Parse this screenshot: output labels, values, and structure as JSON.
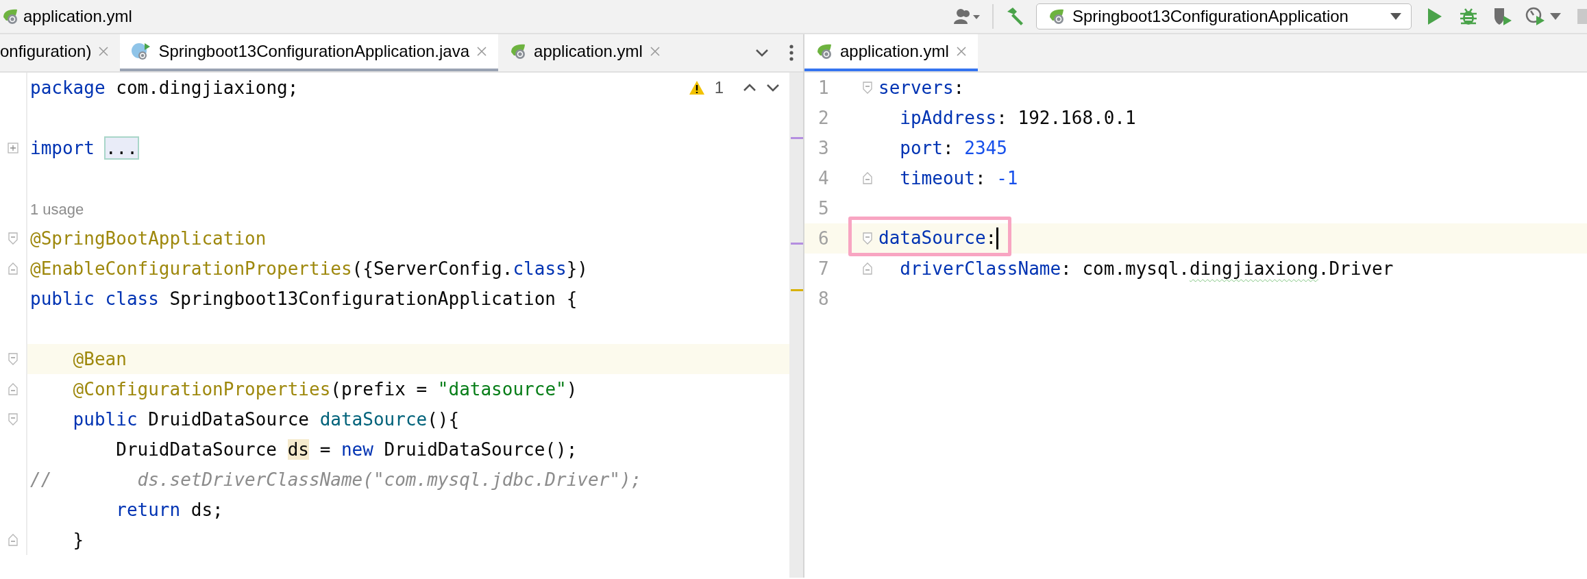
{
  "title_bar": {
    "file_name": "application.yml",
    "run_configuration": "Springboot13ConfigurationApplication"
  },
  "left_editor": {
    "active": false,
    "tabs": [
      {
        "label": "onfiguration)",
        "kind": "plain",
        "selected": false
      },
      {
        "label": "Springboot13ConfigurationApplication.java",
        "kind": "java",
        "selected": true
      },
      {
        "label": "application.yml",
        "kind": "yaml",
        "selected": false
      }
    ],
    "warning_count": "1",
    "lines": [
      {
        "kind": "plain",
        "current": false,
        "tokens": [
          {
            "t": "package",
            "kind": "keyword"
          },
          {
            "t": " com.dingjiaxiong;",
            "kind": "text"
          }
        ]
      },
      {
        "kind": "plain",
        "current": false
      },
      {
        "kind": "collapsed",
        "current": false,
        "tokens": [
          {
            "t": "import",
            "kind": "keyword"
          },
          {
            "t": " ...",
            "kind": "placeholder"
          }
        ]
      },
      {
        "kind": "plain",
        "current": false
      },
      {
        "kind": "plain",
        "current": false,
        "tokens": [
          {
            "t": "1 usage",
            "kind": "hint"
          }
        ]
      },
      {
        "kind": "fold-start",
        "current": false,
        "tokens": [
          {
            "t": "@SpringBootApplication",
            "kind": "annotation"
          }
        ]
      },
      {
        "kind": "fold-end",
        "current": false,
        "tokens": [
          {
            "t": "@EnableConfigurationProperties",
            "kind": "annotation"
          },
          {
            "t": "({ServerConfig.",
            "kind": "text"
          },
          {
            "t": "class",
            "kind": "keyword"
          },
          {
            "t": "})",
            "kind": "text"
          }
        ]
      },
      {
        "kind": "plain",
        "current": false,
        "tokens": [
          {
            "t": "public class",
            "kind": "keyword"
          },
          {
            "t": " Springboot13ConfigurationApplication {",
            "kind": "text"
          }
        ]
      },
      {
        "kind": "plain",
        "current": false
      },
      {
        "kind": "fold-start",
        "current": true,
        "tokens": [
          {
            "t": "    @Bean",
            "kind": "annotation"
          }
        ]
      },
      {
        "kind": "fold-end",
        "current": false,
        "tokens": [
          {
            "t": "    @ConfigurationProperties",
            "kind": "annotation"
          },
          {
            "t": "(prefix = ",
            "kind": "text"
          },
          {
            "t": "\"datasource\"",
            "kind": "string"
          },
          {
            "t": ")",
            "kind": "text"
          }
        ]
      },
      {
        "kind": "fold-start",
        "current": false,
        "tokens": [
          {
            "t": "    public",
            "kind": "keyword"
          },
          {
            "t": " DruidDataSource ",
            "kind": "text"
          },
          {
            "t": "dataSource",
            "kind": "method"
          },
          {
            "t": "(){",
            "kind": "text"
          }
        ]
      },
      {
        "kind": "plain",
        "current": false,
        "tokens": [
          {
            "t": "        DruidDataSource ",
            "kind": "text"
          },
          {
            "t": "ds",
            "kind": "usage"
          },
          {
            "t": " = ",
            "kind": "text"
          },
          {
            "t": "new",
            "kind": "keyword"
          },
          {
            "t": " DruidDataSource();",
            "kind": "text"
          }
        ]
      },
      {
        "kind": "plain",
        "current": false,
        "tokens": [
          {
            "t": "//        ds.setDriverClassName(\"com.mysql.jdbc.Driver\");",
            "kind": "comment"
          }
        ]
      },
      {
        "kind": "plain",
        "current": false,
        "tokens": [
          {
            "t": "        return",
            "kind": "keyword"
          },
          {
            "t": " ds;",
            "kind": "text"
          }
        ]
      },
      {
        "kind": "fold-end",
        "current": false,
        "tokens": [
          {
            "t": "    }",
            "kind": "text"
          }
        ]
      }
    ]
  },
  "right_editor": {
    "active": true,
    "tabs": [
      {
        "label": "application.yml",
        "kind": "yaml",
        "selected": true
      }
    ],
    "lines": [
      {
        "number": "1",
        "kind": "fold-start",
        "current": false,
        "caret": false,
        "framed": false,
        "tokens": [
          {
            "t": "servers",
            "kind": "key"
          },
          {
            "t": ":",
            "kind": "text"
          }
        ]
      },
      {
        "number": "2",
        "kind": "plain",
        "current": false,
        "caret": false,
        "framed": false,
        "tokens": [
          {
            "t": "  ipAddress",
            "kind": "key"
          },
          {
            "t": ": 192.168.0.1",
            "kind": "text"
          }
        ]
      },
      {
        "number": "3",
        "kind": "plain",
        "current": false,
        "caret": false,
        "framed": false,
        "tokens": [
          {
            "t": "  port",
            "kind": "key"
          },
          {
            "t": ": ",
            "kind": "text"
          },
          {
            "t": "2345",
            "kind": "number"
          }
        ]
      },
      {
        "number": "4",
        "kind": "fold-end",
        "current": false,
        "caret": false,
        "framed": false,
        "tokens": [
          {
            "t": "  timeout",
            "kind": "key"
          },
          {
            "t": ": ",
            "kind": "text"
          },
          {
            "t": "-1",
            "kind": "number"
          }
        ]
      },
      {
        "number": "5",
        "kind": "plain",
        "current": false,
        "caret": false,
        "framed": false
      },
      {
        "number": "6",
        "kind": "fold-start",
        "current": true,
        "caret": true,
        "framed": true,
        "tokens": [
          {
            "t": "dataSource",
            "kind": "key"
          },
          {
            "t": ":",
            "kind": "text"
          }
        ]
      },
      {
        "number": "7",
        "kind": "fold-end",
        "current": false,
        "caret": false,
        "framed": false,
        "tokens": [
          {
            "t": "  driverClassName",
            "kind": "key"
          },
          {
            "t": ": com.mysql.",
            "kind": "text"
          },
          {
            "t": "dingjiaxiong",
            "kind": "typo"
          },
          {
            "t": ".Driver",
            "kind": "text"
          }
        ]
      },
      {
        "number": "8",
        "kind": "plain",
        "current": false,
        "caret": false,
        "framed": false
      }
    ]
  }
}
